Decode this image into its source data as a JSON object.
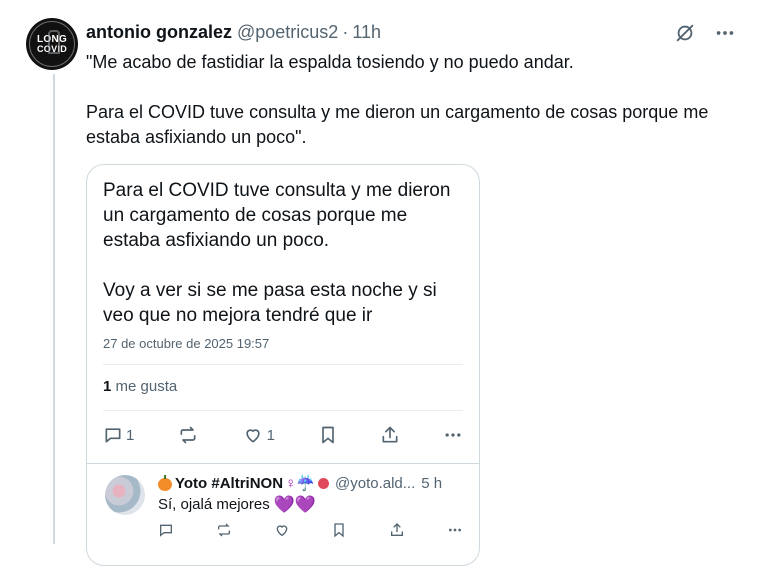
{
  "author": {
    "avatar_line1": "LONG",
    "avatar_line2": "COVID",
    "name": "antonio gonzalez",
    "handle": "@poetricus2",
    "separator": "·",
    "time": "11h"
  },
  "tweet": {
    "paragraph1": "\"Me acabo de fastidiar la espalda tosiendo y no puedo andar.",
    "paragraph2": "Para el COVID tuve consulta y me dieron un cargamento de cosas porque me estaba asfixiando un poco\"."
  },
  "quoted_post": {
    "paragraph1": "Para el COVID tuve consulta y me dieron un cargamento de cosas porque me estaba asfixiando un poco.",
    "paragraph2": "Voy a ver si se me pasa esta noche y si veo que no mejora tendré que ir",
    "date": "27 de octubre de 2025 19:57",
    "likes_count": "1",
    "likes_label": "me gusta",
    "reply_count": "1",
    "like_count": "1"
  },
  "reply": {
    "name": "Yoto #AltriNON",
    "symbols": "♀☔",
    "handle": "@yoto.ald...",
    "time": "5 h",
    "text": "Sí, ojalá mejores",
    "hearts": "💜💜"
  },
  "icons": {
    "top": [
      "translate-off-icon",
      "more-icon"
    ],
    "actions": [
      "reply-icon",
      "repost-icon",
      "like-icon",
      "bookmark-icon",
      "share-icon",
      "more-icon"
    ]
  },
  "colors": {
    "text": "#0f1419",
    "secondary": "#536471",
    "border": "#cfd9de",
    "purple_heart": "#7b2fbe"
  }
}
